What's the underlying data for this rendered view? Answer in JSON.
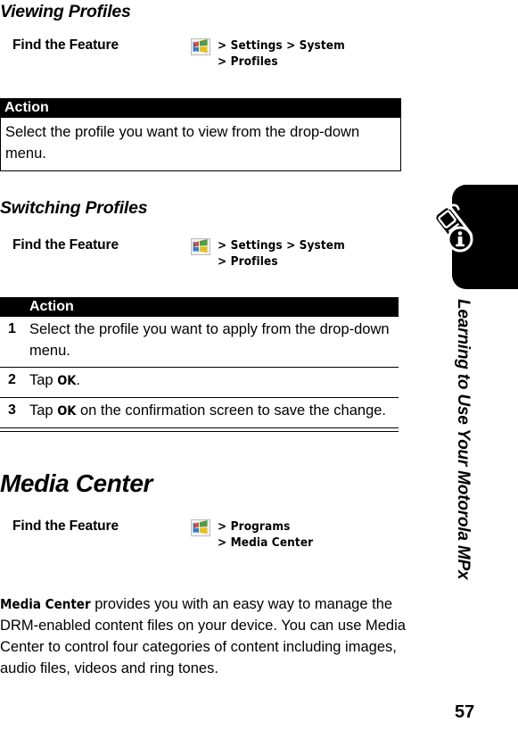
{
  "page": {
    "number": "57",
    "side_tab_text": "Learning to Use Your Motorola MPx",
    "side_tab_icon": "phone-info-icon"
  },
  "sections": [
    {
      "heading": "Viewing Profiles",
      "find_the_feature": {
        "label": "Find the Feature",
        "icon": "windows-start-icon",
        "path_line_1": "> Settings > System",
        "path_line_2": "> Profiles"
      },
      "table": {
        "header": "Action",
        "body": "Select the profile you want to view from the drop-down menu."
      }
    },
    {
      "heading": "Switching Profiles",
      "find_the_feature": {
        "label": "Find the Feature",
        "icon": "windows-start-icon",
        "path_line_1": "> Settings > System",
        "path_line_2": "> Profiles"
      },
      "table": {
        "header": "Action",
        "rows": [
          {
            "num": "1",
            "pre": "Select the profile you want to apply from the drop-down menu.",
            "strong": "",
            "post": ""
          },
          {
            "num": "2",
            "pre": "Tap ",
            "strong": "OK",
            "post": "."
          },
          {
            "num": "3",
            "pre": "Tap ",
            "strong": "OK",
            "post": " on the confirmation screen to save the change."
          }
        ]
      }
    },
    {
      "heading": "Media Center",
      "find_the_feature": {
        "label": "Find the Feature",
        "icon": "windows-start-icon",
        "path_line_1": "> Programs",
        "path_line_2": "> Media Center"
      },
      "paragraph": {
        "strong": "Media Center",
        "text": " provides you with an easy way to manage the DRM-enabled content files on your device. You can use Media Center to control four categories of content including images, audio files, videos and ring tones."
      }
    }
  ]
}
